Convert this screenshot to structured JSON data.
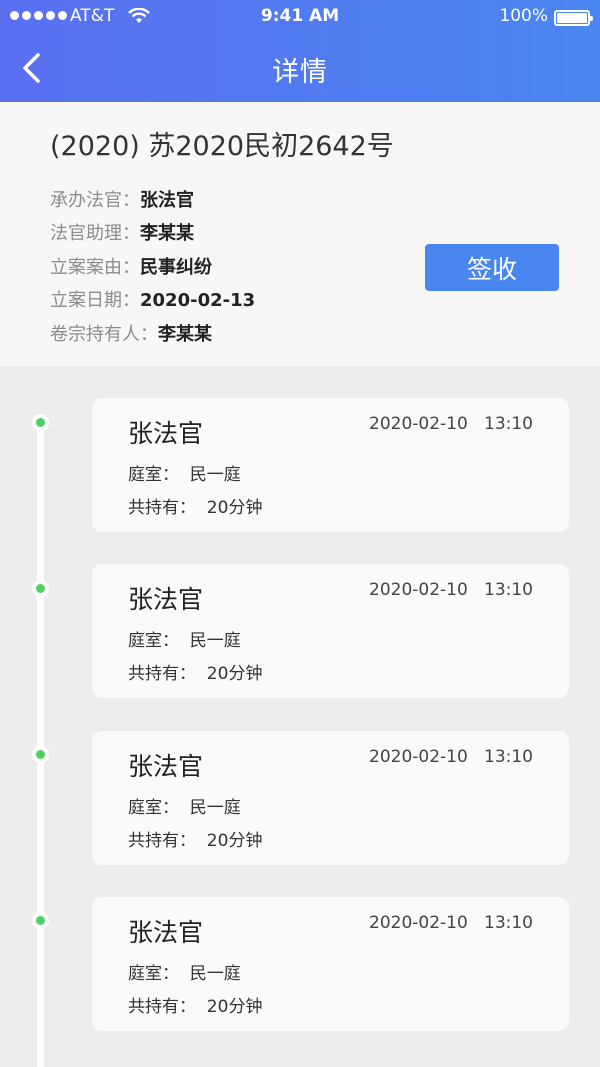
{
  "status_bar": {
    "carrier": "AT&T",
    "time": "9:41 AM",
    "battery": "100%"
  },
  "nav": {
    "title": "详情"
  },
  "case": {
    "title": "(2020) 苏2020民初2642号",
    "fields": [
      {
        "label": "承办法官：",
        "value": "张法官"
      },
      {
        "label": "法官助理：",
        "value": "李某某"
      },
      {
        "label": "立案案由：",
        "value": "民事纠纷"
      },
      {
        "label": "立案日期：",
        "value": "2020-02-13"
      },
      {
        "label": "卷宗持有人：",
        "value": "李某某"
      }
    ],
    "sign_button": "签收"
  },
  "records": [
    {
      "name": "张法官",
      "datetime": "2020-02-10   13:10",
      "room": "庭室：  民一庭",
      "duration": "共持有：  20分钟"
    },
    {
      "name": "张法官",
      "datetime": "2020-02-10   13:10",
      "room": "庭室：  民一庭",
      "duration": "共持有：  20分钟"
    },
    {
      "name": "张法官",
      "datetime": "2020-02-10   13:10",
      "room": "庭室：  民一庭",
      "duration": "共持有：  20分钟"
    },
    {
      "name": "张法官",
      "datetime": "2020-02-10   13:10",
      "room": "庭室：  民一庭",
      "duration": "共持有：  20分钟"
    }
  ],
  "colors": {
    "header_gradient_start": "#5a6ff0",
    "header_gradient_end": "#4a86f0",
    "button": "#4a86ef",
    "timeline_dot": "#4cd25f"
  }
}
